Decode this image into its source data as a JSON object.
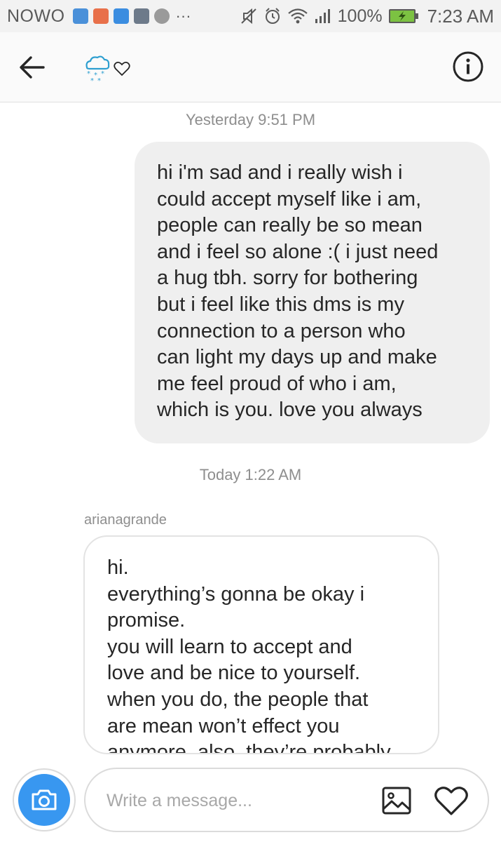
{
  "status_bar": {
    "carrier": "NOWO",
    "battery_percent": "100%",
    "time": "7:23 AM",
    "app_icon_colors": [
      "#4a90d9",
      "#e8704a",
      "#3b8de0",
      "#6d7a8a"
    ],
    "icons": [
      "mute-icon",
      "alarm-icon",
      "wifi-icon",
      "signal-icon",
      "battery-charging-icon"
    ]
  },
  "header": {
    "avatar_icons": [
      "snow-cloud-icon",
      "heart-outline-icon"
    ],
    "accent_color": "#2e9fd0"
  },
  "chat": {
    "timestamp_1": "Yesterday 9:51 PM",
    "outgoing_message": {
      "lines": [
        "hi i'm sad and i really wish i",
        "could accept myself like i am,",
        "people can really be so mean",
        "and i feel so alone :( i just need",
        "a hug tbh. sorry for bothering",
        "but i feel like this dms is my",
        "connection to a person who",
        "can light my days up and make",
        "me feel proud of who i am,",
        "which is you. love you always"
      ]
    },
    "timestamp_2": "Today 1:22 AM",
    "incoming_sender": "arianagrande",
    "incoming_message": {
      "lines": [
        "hi.",
        "everything’s gonna be okay i",
        "promise.",
        "you will learn to accept and",
        "love and be nice to yourself.",
        "when you do, the people that",
        "are mean won’t effect you",
        "anymore. also, they’re probably"
      ]
    }
  },
  "composer": {
    "placeholder": "Write a message...",
    "value": "",
    "camera_color": "#3897f0"
  }
}
